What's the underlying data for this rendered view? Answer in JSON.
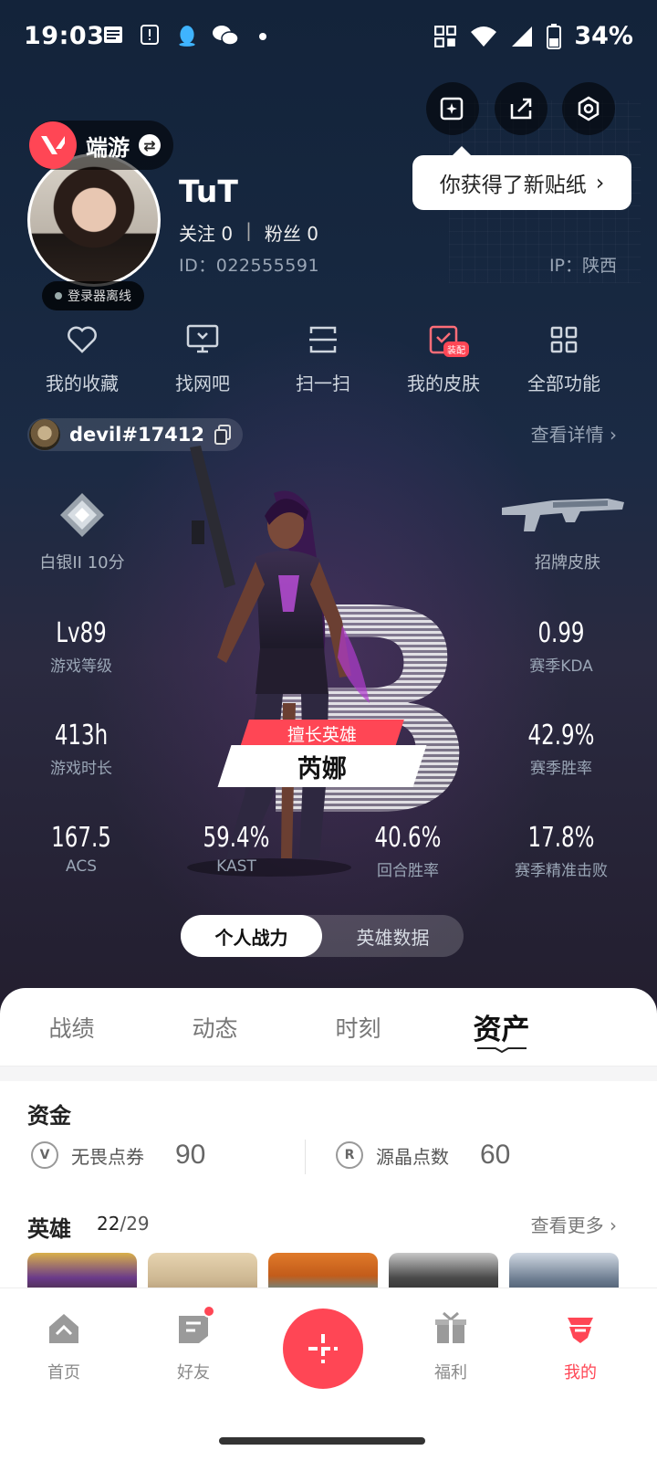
{
  "status_bar": {
    "time": "19:03",
    "battery": "34%"
  },
  "tooltip": {
    "text": "你获得了新贴纸"
  },
  "profile": {
    "game": "端游",
    "offline": "登录器离线",
    "nickname": "TuT",
    "follow_label": "关注",
    "follow_count": "0",
    "separator": "|",
    "fans_label": "粉丝",
    "fans_count": "0",
    "id": "ID：022555591",
    "ip": "IP：陕西"
  },
  "quick": [
    {
      "label": "我的收藏",
      "icon": "heart-icon"
    },
    {
      "label": "找网吧",
      "icon": "monitor-icon"
    },
    {
      "label": "扫一扫",
      "icon": "scan-icon"
    },
    {
      "label": "我的皮肤",
      "icon": "skin-icon",
      "tag": "装配"
    },
    {
      "label": "全部功能",
      "icon": "grid-icon"
    }
  ],
  "account": {
    "name": "devil#17412",
    "detail": "查看详情"
  },
  "rank": {
    "label": "白银II 10分"
  },
  "skin": {
    "label": "招牌皮肤"
  },
  "stats": {
    "level": {
      "value": "Lv89",
      "label": "游戏等级"
    },
    "kda": {
      "value": "0.99",
      "label": "赛季KDA"
    },
    "hours": {
      "value": "413h",
      "label": "游戏时长"
    },
    "winrate": {
      "value": "42.9%",
      "label": "赛季胜率"
    },
    "acs": {
      "value": "167.5",
      "label": "ACS"
    },
    "kast": {
      "value": "59.4%",
      "label": "KAST"
    },
    "round_win": {
      "value": "40.6%",
      "label": "回合胜率"
    },
    "precise": {
      "value": "17.8%",
      "label": "赛季精准击败"
    }
  },
  "hero": {
    "tag": "擅长英雄",
    "name": "芮娜",
    "letter": "B"
  },
  "segment": {
    "on": "个人战力",
    "off": "英雄数据"
  },
  "tabs": [
    "战绩",
    "动态",
    "时刻",
    "资产"
  ],
  "funds": {
    "title": "资金",
    "items": [
      {
        "name": "无畏点券",
        "value": "90"
      },
      {
        "name": "源晶点数",
        "value": "60"
      }
    ]
  },
  "heroes": {
    "title": "英雄",
    "owned": "22",
    "total": "/29",
    "more": "查看更多"
  },
  "nav": [
    {
      "label": "首页"
    },
    {
      "label": "好友"
    },
    {
      "label": "福利"
    },
    {
      "label": "我的"
    }
  ],
  "colors": {
    "accent": "#ff4655",
    "bg": "#13233a"
  }
}
